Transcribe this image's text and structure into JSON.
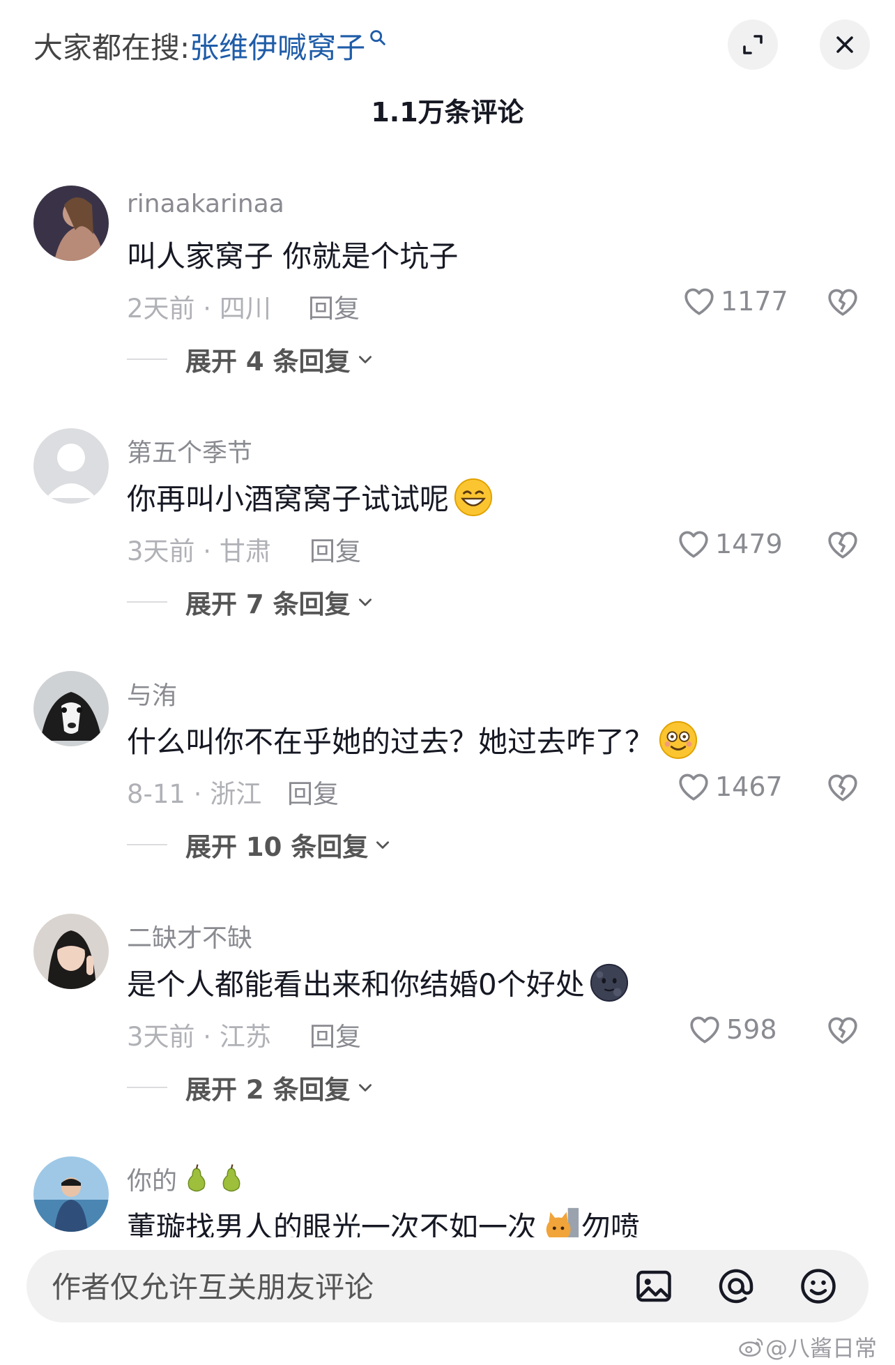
{
  "header": {
    "search_prefix": "大家都在搜:",
    "search_term": "张维伊喊窝子",
    "comment_count": "1.1万条评论"
  },
  "comments": [
    {
      "username": "rinaakarinaa",
      "text": "叫人家窝子 你就是个坑子",
      "time_location": "2天前 · 四川",
      "reply": "回复",
      "likes": "1177",
      "expand": "展开 4 条回复"
    },
    {
      "username": "第五个季节",
      "text": "你再叫小酒窝窝子试试呢",
      "time_location": "3天前 · 甘肃",
      "reply": "回复",
      "likes": "1479",
      "expand": "展开 7 条回复"
    },
    {
      "username": "与洧",
      "text": "什么叫你不在乎她的过去？她过去咋了？",
      "time_location": "8-11 · 浙江",
      "reply": "回复",
      "likes": "1467",
      "expand": "展开 10 条回复"
    },
    {
      "username": "二缺才不缺",
      "text": "是个人都能看出来和你结婚0个好处",
      "time_location": "3天前 · 江苏",
      "reply": "回复",
      "likes": "598",
      "expand": "展开 2 条回复"
    },
    {
      "username": "你的",
      "text_a": "董璇找男人的眼光一次不如一次",
      "text_b": "勿喷"
    }
  ],
  "input": {
    "placeholder": "作者仅允许互关朋友评论"
  },
  "watermark": "@八酱日常",
  "icons": [
    "search-icon",
    "expand-icon",
    "close-icon",
    "heart-icon",
    "broken-heart-icon",
    "chevron-down-icon",
    "image-icon",
    "at-icon",
    "smiley-icon",
    "weibo-logo-icon"
  ]
}
